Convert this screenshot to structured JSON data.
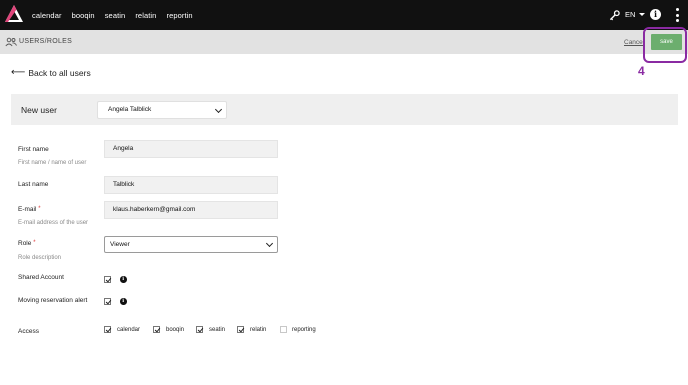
{
  "nav": {
    "items": [
      "calendar",
      "booqin",
      "seatin",
      "relatin",
      "reportin"
    ],
    "language": "EN"
  },
  "subheader": {
    "title": "USERS/ROLES",
    "cancel": "Cancel",
    "save": "save"
  },
  "annotation": {
    "step": "4",
    "color": "#8a2aa2"
  },
  "back_link": "Back to all users",
  "panel": {
    "title": "New user",
    "selected_user": "Angela Talblick"
  },
  "form": {
    "first_name": {
      "label": "First name",
      "hint": "First name / name of user",
      "value": "Angela"
    },
    "last_name": {
      "label": "Last name",
      "value": "Talblick"
    },
    "email": {
      "label": "E-mail",
      "required": "*",
      "hint": "E-mail address of the user",
      "value": "klaus.haberkern@gmail.com"
    },
    "role": {
      "label": "Role",
      "required": "*",
      "hint": "Role description",
      "value": "Viewer"
    },
    "shared_account": {
      "label": "Shared Account",
      "checked": true
    },
    "moving_alert": {
      "label": "Moving reservation alert",
      "checked": true
    },
    "access": {
      "label": "Access",
      "items": [
        {
          "name": "calendar",
          "checked": true
        },
        {
          "name": "booqin",
          "checked": true
        },
        {
          "name": "seatin",
          "checked": true
        },
        {
          "name": "relatin",
          "checked": true
        },
        {
          "name": "reporting",
          "checked": false
        }
      ]
    }
  },
  "colors": {
    "topbar": "#111111",
    "save_button": "#6cae6e",
    "accent": "#8a2aa2"
  }
}
